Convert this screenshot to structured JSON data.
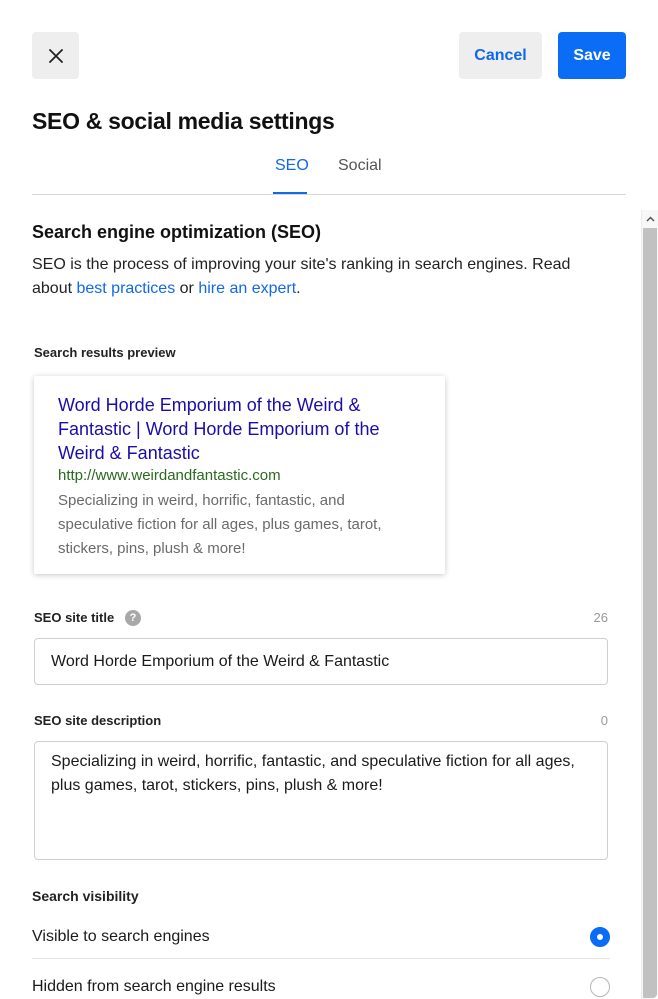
{
  "header": {
    "cancel_label": "Cancel",
    "save_label": "Save",
    "title": "SEO & social media settings"
  },
  "tabs": [
    {
      "label": "SEO",
      "active": true
    },
    {
      "label": "Social",
      "active": false
    }
  ],
  "seo": {
    "heading": "Search engine optimization (SEO)",
    "intro_text": "SEO is the process of improving your site's ranking in search engines. Read about ",
    "link_best_practices": "best practices",
    "intro_or": " or ",
    "link_hire_expert": "hire an expert",
    "intro_end": ".",
    "preview": {
      "label": "Search results preview",
      "title": "Word Horde Emporium of the Weird & Fantastic | Word Horde Emporium of the Weird & Fantastic",
      "url": "http://www.weirdandfantastic.com",
      "description": "Specializing in weird, horrific, fantastic, and speculative fiction for all ages, plus games, tarot, stickers, pins, plush & more!"
    },
    "site_title": {
      "label": "SEO site title",
      "help_glyph": "?",
      "counter": "26",
      "value": "Word Horde Emporium of the Weird & Fantastic"
    },
    "site_description": {
      "label": "SEO site description",
      "counter": "0",
      "value": "Specializing in weird, horrific, fantastic, and speculative fiction for all ages, plus games, tarot, stickers, pins, plush & more!"
    },
    "visibility": {
      "heading": "Search visibility",
      "options": [
        {
          "label": "Visible to search engines",
          "selected": true
        },
        {
          "label": "Hidden from search engine results",
          "selected": false
        }
      ]
    }
  },
  "icons": {
    "close": "close-icon",
    "scroll_up": "chevron-up-icon",
    "help": "question-circle-icon"
  },
  "colors": {
    "accent": "#0b6cf5",
    "link": "#1168e8",
    "preview_title": "#1a0dab",
    "preview_url": "#2a6a1e"
  }
}
